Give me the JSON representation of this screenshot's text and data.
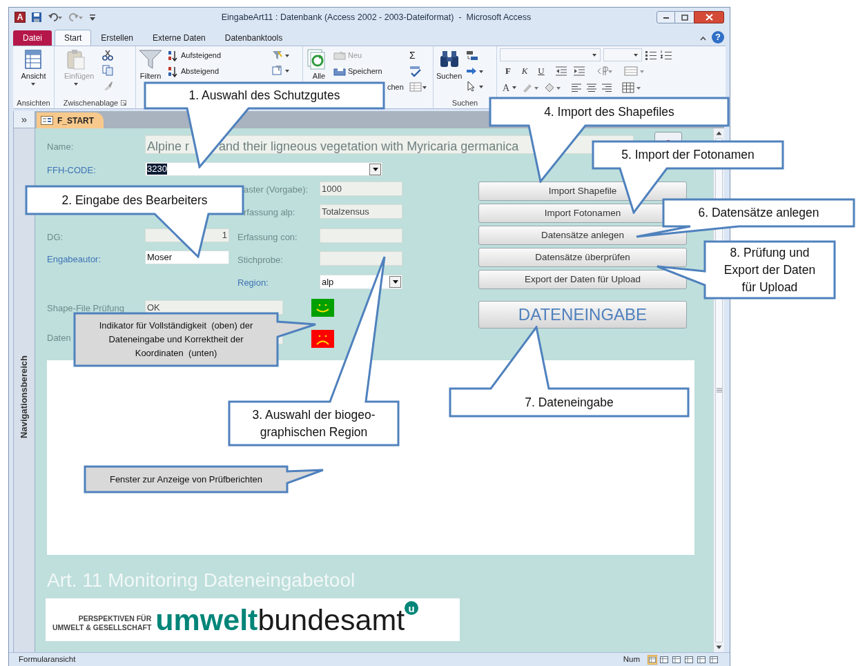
{
  "title_bar": {
    "app_icon": "A",
    "title": "EingabeArt11 : Datenbank (Access 2002 - 2003-Dateiformat)  -  Microsoft Access"
  },
  "ribbon_tabs": [
    {
      "label": "Datei",
      "kind": "file",
      "selected": false
    },
    {
      "label": "Start",
      "kind": "tab",
      "selected": true
    },
    {
      "label": "Erstellen",
      "kind": "tab",
      "selected": false
    },
    {
      "label": "Externe Daten",
      "kind": "tab",
      "selected": false
    },
    {
      "label": "Datenbanktools",
      "kind": "tab",
      "selected": false
    }
  ],
  "help_icon": "?",
  "ribbon": {
    "view_button": {
      "label": "Ansicht",
      "disabled": false
    },
    "paste_button": {
      "label": "Einfügen",
      "disabled": true
    },
    "filter_button": {
      "label": "Filtern",
      "disabled": false
    },
    "sort_buttons": [
      {
        "label": "Aufsteigend",
        "kind": "ascending"
      },
      {
        "label": "Absteigend",
        "kind": "descending"
      }
    ],
    "refresh_button": {
      "label": "Alle"
    },
    "record_buttons": [
      {
        "label": "Neu",
        "disabled": true
      },
      {
        "label": "Speichern",
        "disabled": false
      },
      {
        "label": "chen",
        "disabled": false
      }
    ],
    "sum_glyph": "Σ",
    "find_button": {
      "label": "Suchen"
    },
    "format_letters": [
      {
        "label": "F",
        "kind": "bold"
      },
      {
        "label": "K",
        "kind": "italic"
      },
      {
        "label": "U",
        "kind": "underline"
      }
    ],
    "font_color_letter": "A",
    "group_labels": [
      "Ansichten",
      "Zwischenablage",
      "Suchen"
    ]
  },
  "nav_pane": {
    "toggle": "»",
    "label": "Navigationsbereich"
  },
  "document_tab": {
    "label": "F_START"
  },
  "form": {
    "name_field": {
      "label": "Name:",
      "value_parts": [
        "Alpine r",
        "and their ligneous vegetation with Myricaria germanica"
      ]
    },
    "fields": [
      {
        "label": "FFH-CODE:",
        "value": "3230",
        "kind": "combo",
        "enabled": true,
        "value_selected": true
      },
      {
        "label": "aster (Vorgabe):",
        "value": "1000",
        "kind": "text",
        "enabled": false
      },
      {
        "label": "rfassung alp:",
        "value": "Totalzensus",
        "kind": "text",
        "enabled": false
      },
      {
        "label": "DG:",
        "value": "1",
        "kind": "number",
        "enabled": false
      },
      {
        "label": "Erfassung con:",
        "kind": "text",
        "enabled": false
      },
      {
        "label": "Engabeautor:",
        "value": "Moser",
        "kind": "text",
        "enabled": true
      },
      {
        "label": "Stichprobe:",
        "kind": "text",
        "enabled": false
      },
      {
        "label": "Region:",
        "value": "alp",
        "kind": "combo",
        "enabled": true
      },
      {
        "label": "Shape-File Prüfung",
        "value": "OK",
        "kind": "text",
        "enabled": false
      },
      {
        "label": "Daten",
        "kind": "text",
        "enabled": false
      }
    ],
    "indicators": [
      {
        "kind": "happy",
        "color": "#00a000"
      },
      {
        "kind": "sad",
        "color": "#ff0000"
      }
    ],
    "buttons": [
      "Import Shapefile",
      "Import Fotonamen",
      "Datensätze anlegen",
      "Datensätze überprüfen",
      "Export der Daten für Upload"
    ],
    "main_button": "DATENEINGABE",
    "footer_title": "Art. 11 Monitoring Dateneingabetool",
    "logo": {
      "tagline": [
        "PERSPEKTIVEN FÜR",
        "UMWELT & GESELLSCHAFT"
      ],
      "word_bold": "umwelt",
      "word_regular": "bundesamt",
      "badge": "u"
    }
  },
  "status_bar": {
    "left": "Formularansicht",
    "right": "Num"
  },
  "callouts": [
    {
      "text": "1. Auswahl des Schutzgutes",
      "kind": "white"
    },
    {
      "text": "2. Eingabe des Bearbeiters",
      "kind": "white"
    },
    {
      "text": "3. Auswahl der biogeo-\ngraphischen Region",
      "kind": "white"
    },
    {
      "text": "4. Import des Shapefiles",
      "kind": "white"
    },
    {
      "text": "5. Import der Fotonamen",
      "kind": "white"
    },
    {
      "text": "6. Datensätze anlegen",
      "kind": "white"
    },
    {
      "text": "7. Dateneingabe",
      "kind": "white"
    },
    {
      "text": "8. Prüfung und\nExport der Daten\nfür Upload",
      "kind": "white"
    },
    {
      "text": "Indikator für Vollständigkeit  (oben) der\nDateneingabe und Korrektheit der\nKoordinaten  (unten)",
      "kind": "gray"
    },
    {
      "text": "Fenster zur Anzeige von Prüfberichten",
      "kind": "gray"
    }
  ]
}
